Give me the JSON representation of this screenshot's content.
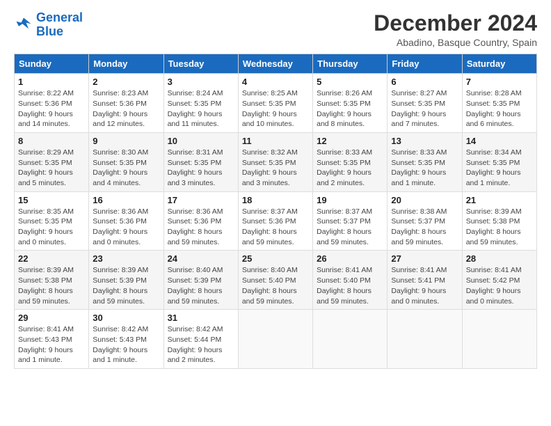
{
  "logo": {
    "line1": "General",
    "line2": "Blue"
  },
  "title": "December 2024",
  "subtitle": "Abadino, Basque Country, Spain",
  "headers": [
    "Sunday",
    "Monday",
    "Tuesday",
    "Wednesday",
    "Thursday",
    "Friday",
    "Saturday"
  ],
  "weeks": [
    [
      {
        "day": "1",
        "info": "Sunrise: 8:22 AM\nSunset: 5:36 PM\nDaylight: 9 hours and 14 minutes."
      },
      {
        "day": "2",
        "info": "Sunrise: 8:23 AM\nSunset: 5:36 PM\nDaylight: 9 hours and 12 minutes."
      },
      {
        "day": "3",
        "info": "Sunrise: 8:24 AM\nSunset: 5:35 PM\nDaylight: 9 hours and 11 minutes."
      },
      {
        "day": "4",
        "info": "Sunrise: 8:25 AM\nSunset: 5:35 PM\nDaylight: 9 hours and 10 minutes."
      },
      {
        "day": "5",
        "info": "Sunrise: 8:26 AM\nSunset: 5:35 PM\nDaylight: 9 hours and 8 minutes."
      },
      {
        "day": "6",
        "info": "Sunrise: 8:27 AM\nSunset: 5:35 PM\nDaylight: 9 hours and 7 minutes."
      },
      {
        "day": "7",
        "info": "Sunrise: 8:28 AM\nSunset: 5:35 PM\nDaylight: 9 hours and 6 minutes."
      }
    ],
    [
      {
        "day": "8",
        "info": "Sunrise: 8:29 AM\nSunset: 5:35 PM\nDaylight: 9 hours and 5 minutes."
      },
      {
        "day": "9",
        "info": "Sunrise: 8:30 AM\nSunset: 5:35 PM\nDaylight: 9 hours and 4 minutes."
      },
      {
        "day": "10",
        "info": "Sunrise: 8:31 AM\nSunset: 5:35 PM\nDaylight: 9 hours and 3 minutes."
      },
      {
        "day": "11",
        "info": "Sunrise: 8:32 AM\nSunset: 5:35 PM\nDaylight: 9 hours and 3 minutes."
      },
      {
        "day": "12",
        "info": "Sunrise: 8:33 AM\nSunset: 5:35 PM\nDaylight: 9 hours and 2 minutes."
      },
      {
        "day": "13",
        "info": "Sunrise: 8:33 AM\nSunset: 5:35 PM\nDaylight: 9 hours and 1 minute."
      },
      {
        "day": "14",
        "info": "Sunrise: 8:34 AM\nSunset: 5:35 PM\nDaylight: 9 hours and 1 minute."
      }
    ],
    [
      {
        "day": "15",
        "info": "Sunrise: 8:35 AM\nSunset: 5:35 PM\nDaylight: 9 hours and 0 minutes."
      },
      {
        "day": "16",
        "info": "Sunrise: 8:36 AM\nSunset: 5:36 PM\nDaylight: 9 hours and 0 minutes."
      },
      {
        "day": "17",
        "info": "Sunrise: 8:36 AM\nSunset: 5:36 PM\nDaylight: 8 hours and 59 minutes."
      },
      {
        "day": "18",
        "info": "Sunrise: 8:37 AM\nSunset: 5:36 PM\nDaylight: 8 hours and 59 minutes."
      },
      {
        "day": "19",
        "info": "Sunrise: 8:37 AM\nSunset: 5:37 PM\nDaylight: 8 hours and 59 minutes."
      },
      {
        "day": "20",
        "info": "Sunrise: 8:38 AM\nSunset: 5:37 PM\nDaylight: 8 hours and 59 minutes."
      },
      {
        "day": "21",
        "info": "Sunrise: 8:39 AM\nSunset: 5:38 PM\nDaylight: 8 hours and 59 minutes."
      }
    ],
    [
      {
        "day": "22",
        "info": "Sunrise: 8:39 AM\nSunset: 5:38 PM\nDaylight: 8 hours and 59 minutes."
      },
      {
        "day": "23",
        "info": "Sunrise: 8:39 AM\nSunset: 5:39 PM\nDaylight: 8 hours and 59 minutes."
      },
      {
        "day": "24",
        "info": "Sunrise: 8:40 AM\nSunset: 5:39 PM\nDaylight: 8 hours and 59 minutes."
      },
      {
        "day": "25",
        "info": "Sunrise: 8:40 AM\nSunset: 5:40 PM\nDaylight: 8 hours and 59 minutes."
      },
      {
        "day": "26",
        "info": "Sunrise: 8:41 AM\nSunset: 5:40 PM\nDaylight: 8 hours and 59 minutes."
      },
      {
        "day": "27",
        "info": "Sunrise: 8:41 AM\nSunset: 5:41 PM\nDaylight: 9 hours and 0 minutes."
      },
      {
        "day": "28",
        "info": "Sunrise: 8:41 AM\nSunset: 5:42 PM\nDaylight: 9 hours and 0 minutes."
      }
    ],
    [
      {
        "day": "29",
        "info": "Sunrise: 8:41 AM\nSunset: 5:43 PM\nDaylight: 9 hours and 1 minute."
      },
      {
        "day": "30",
        "info": "Sunrise: 8:42 AM\nSunset: 5:43 PM\nDaylight: 9 hours and 1 minute."
      },
      {
        "day": "31",
        "info": "Sunrise: 8:42 AM\nSunset: 5:44 PM\nDaylight: 9 hours and 2 minutes."
      },
      null,
      null,
      null,
      null
    ]
  ]
}
